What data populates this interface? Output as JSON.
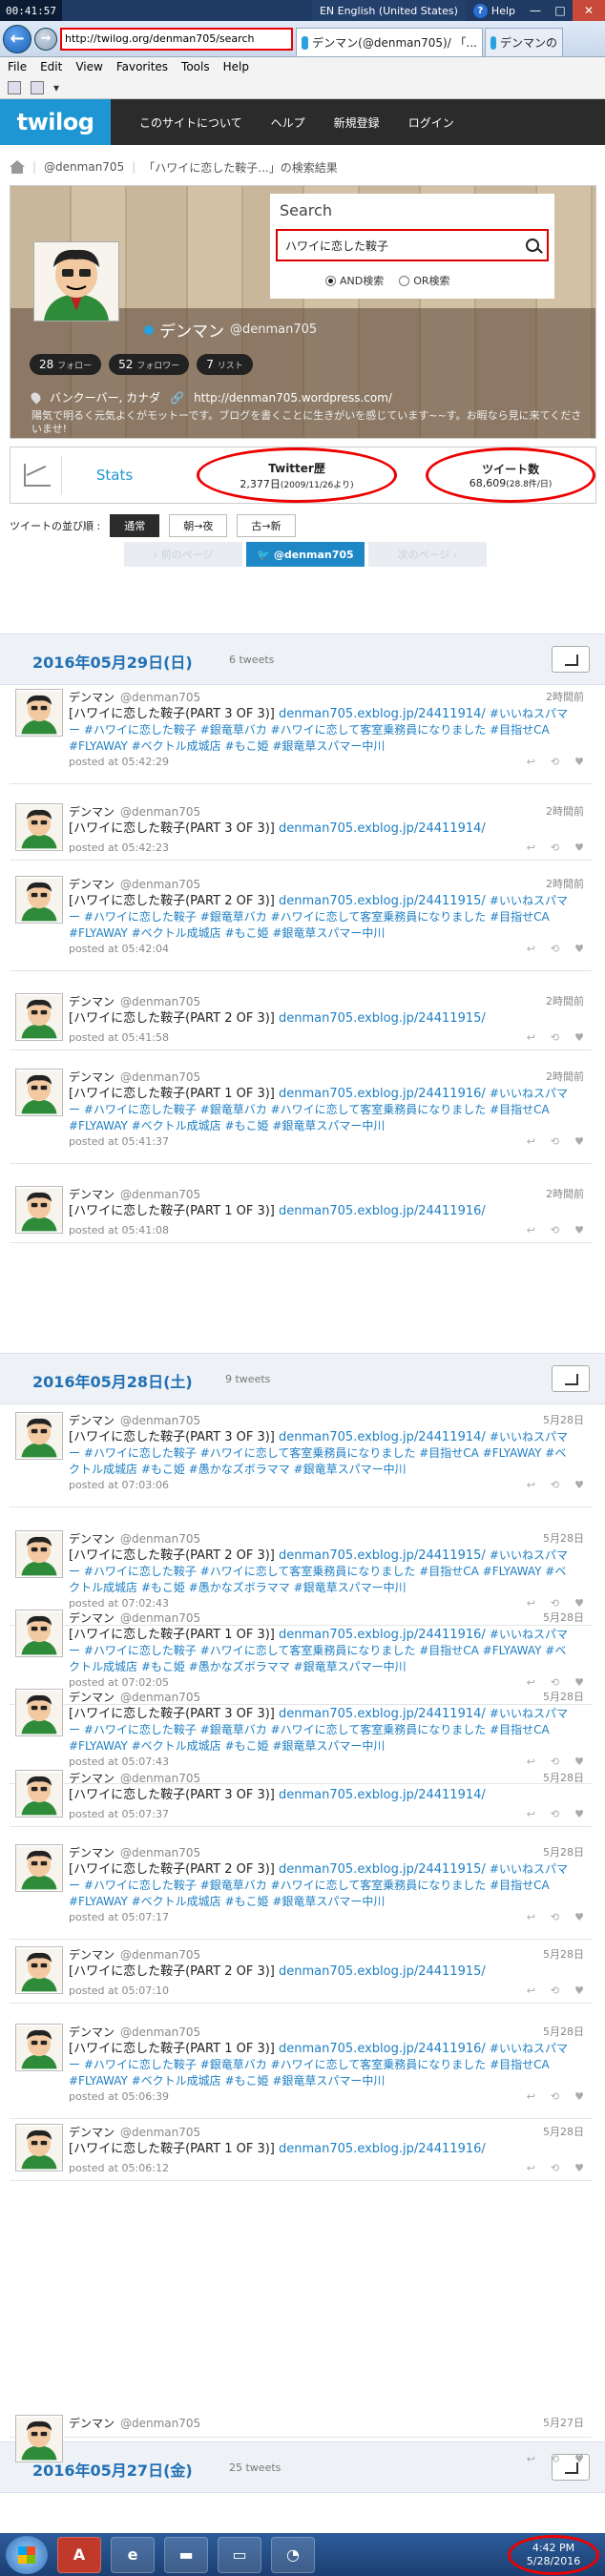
{
  "window": {
    "clock": "00:41:57",
    "language": "EN English (United States)",
    "help": "Help"
  },
  "browser": {
    "address": "http://twilog.org/denman705/search",
    "tabs": [
      {
        "label": "デンマン(@denman705)/ 「..."
      },
      {
        "label": "デンマンの"
      }
    ],
    "menu": [
      "File",
      "Edit",
      "View",
      "Favorites",
      "Tools",
      "Help"
    ]
  },
  "site": {
    "logo": "twilog",
    "nav": [
      "このサイトについて",
      "ヘルプ",
      "新規登録",
      "ログイン"
    ]
  },
  "breadcrumb": {
    "user": "@denman705",
    "current": "「ハワイに恋した鞍子...」の検索結果"
  },
  "search": {
    "title": "Search",
    "query": "ハワイに恋した鞍子",
    "and_label": "AND検索",
    "or_label": "OR検索"
  },
  "profile": {
    "name": "デンマン",
    "handle": "@denman705",
    "follow": "28",
    "follow_label": "フォロー",
    "followers": "52",
    "followers_label": "フォロワー",
    "lists": "7",
    "lists_label": "リスト",
    "location": "バンクーバー, カナダ",
    "url": "http://denman705.wordpress.com/",
    "bio": "陽気で明るく元気よくがモットーです。ブログを書くことに生きがいを感じています~~す。お暇なら見に来てくださいませ!"
  },
  "stats": {
    "label": "Stats",
    "history_title": "Twitter歴",
    "history_value": "2,377日",
    "history_note": "(2009/11/26より)",
    "tweets_title": "ツイート数",
    "tweets_value": "68,609",
    "tweets_note": "(28.8件/日)"
  },
  "sort": {
    "label": "ツイートの並び順 :",
    "options": [
      "通常",
      "朝→夜",
      "古→新"
    ]
  },
  "pager": {
    "prev": "前のページ",
    "user": "@denman705",
    "next": "次のページ"
  },
  "days": [
    {
      "date": "2016年05月29日(日)",
      "count": "6 tweets"
    },
    {
      "date": "2016年05月28日(土)",
      "count": "9 tweets"
    },
    {
      "date": "2016年05月27日(金)",
      "count": "25 tweets"
    }
  ],
  "tweets": [
    {
      "name": "デンマン",
      "handle": "@denman705",
      "time": "2時間前",
      "head": "[ハワイに恋した鞍子(PART 3 OF 3)]",
      "url": "denman705.exblog.jp/24411914/",
      "tags": "#いいねスパマー #ハワイに恋した鞍子 #銀竜草バカ #ハワイに恋して客室乗務員になりました #目指せCA #FLYAWAY #ベクトル成城店 #もこ姫 #銀竜草スパマー中川",
      "posted": "posted at 05:42:29"
    },
    {
      "name": "デンマン",
      "handle": "@denman705",
      "time": "2時間前",
      "head": "[ハワイに恋した鞍子(PART 3 OF 3)]",
      "url": "denman705.exblog.jp/24411914/",
      "tags": "",
      "posted": "posted at 05:42:23"
    },
    {
      "name": "デンマン",
      "handle": "@denman705",
      "time": "2時間前",
      "head": "[ハワイに恋した鞍子(PART 2 OF 3)]",
      "url": "denman705.exblog.jp/24411915/",
      "tags": "#いいねスパマー #ハワイに恋した鞍子 #銀竜草バカ #ハワイに恋して客室乗務員になりました #目指せCA #FLYAWAY #ベクトル成城店 #もこ姫 #銀竜草スパマー中川",
      "posted": "posted at 05:42:04"
    },
    {
      "name": "デンマン",
      "handle": "@denman705",
      "time": "2時間前",
      "head": "[ハワイに恋した鞍子(PART 2 OF 3)]",
      "url": "denman705.exblog.jp/24411915/",
      "tags": "",
      "posted": "posted at 05:41:58"
    },
    {
      "name": "デンマン",
      "handle": "@denman705",
      "time": "2時間前",
      "head": "[ハワイに恋した鞍子(PART 1 OF 3)]",
      "url": "denman705.exblog.jp/24411916/",
      "tags": "#いいねスパマー #ハワイに恋した鞍子 #銀竜草バカ #ハワイに恋して客室乗務員になりました #目指せCA #FLYAWAY #ベクトル成城店 #もこ姫 #銀竜草スパマー中川",
      "posted": "posted at 05:41:37"
    },
    {
      "name": "デンマン",
      "handle": "@denman705",
      "time": "2時間前",
      "head": "[ハワイに恋した鞍子(PART 1 OF 3)]",
      "url": "denman705.exblog.jp/24411916/",
      "tags": "",
      "posted": "posted at 05:41:08"
    },
    {
      "name": "デンマン",
      "handle": "@denman705",
      "time": "5月28日",
      "head": "[ハワイに恋した鞍子(PART 3 OF 3)]",
      "url": "denman705.exblog.jp/24411914/",
      "tags": "#いいねスパマー #ハワイに恋した鞍子 #ハワイに恋して客室乗務員になりました #目指せCA #FLYAWAY #ベクトル成城店 #もこ姫 #愚かなズボラママ #銀竜草スパマー中川",
      "posted": "posted at 07:03:06"
    },
    {
      "name": "デンマン",
      "handle": "@denman705",
      "time": "5月28日",
      "head": "[ハワイに恋した鞍子(PART 2 OF 3)]",
      "url": "denman705.exblog.jp/24411915/",
      "tags": "#いいねスパマー #ハワイに恋した鞍子 #ハワイに恋して客室乗務員になりました #目指せCA #FLYAWAY #ベクトル成城店 #もこ姫 #愚かなズボラママ #銀竜草スパマー中川",
      "posted": "posted at 07:02:43"
    },
    {
      "name": "デンマン",
      "handle": "@denman705",
      "time": "5月28日",
      "head": "[ハワイに恋した鞍子(PART 1 OF 3)]",
      "url": "denman705.exblog.jp/24411916/",
      "tags": "#いいねスパマー #ハワイに恋した鞍子 #ハワイに恋して客室乗務員になりました #目指せCA #FLYAWAY #ベクトル成城店 #もこ姫 #愚かなズボラママ #銀竜草スパマー中川",
      "posted": "posted at 07:02:05"
    },
    {
      "name": "デンマン",
      "handle": "@denman705",
      "time": "5月28日",
      "head": "[ハワイに恋した鞍子(PART 3 OF 3)]",
      "url": "denman705.exblog.jp/24411914/",
      "tags": "#いいねスパマー #ハワイに恋した鞍子 #銀竜草バカ #ハワイに恋して客室乗務員になりました #目指せCA #FLYAWAY #ベクトル成城店 #もこ姫 #銀竜草スパマー中川",
      "posted": "posted at 05:07:43"
    },
    {
      "name": "デンマン",
      "handle": "@denman705",
      "time": "5月28日",
      "head": "[ハワイに恋した鞍子(PART 3 OF 3)]",
      "url": "denman705.exblog.jp/24411914/",
      "tags": "",
      "posted": "posted at 05:07:37"
    },
    {
      "name": "デンマン",
      "handle": "@denman705",
      "time": "5月28日",
      "head": "[ハワイに恋した鞍子(PART 2 OF 3)]",
      "url": "denman705.exblog.jp/24411915/",
      "tags": "#いいねスパマー #ハワイに恋した鞍子 #銀竜草バカ #ハワイに恋して客室乗務員になりました #目指せCA #FLYAWAY #ベクトル成城店 #もこ姫 #銀竜草スパマー中川",
      "posted": "posted at 05:07:17"
    },
    {
      "name": "デンマン",
      "handle": "@denman705",
      "time": "5月28日",
      "head": "[ハワイに恋した鞍子(PART 2 OF 3)]",
      "url": "denman705.exblog.jp/24411915/",
      "tags": "",
      "posted": "posted at 05:07:10"
    },
    {
      "name": "デンマン",
      "handle": "@denman705",
      "time": "5月28日",
      "head": "[ハワイに恋した鞍子(PART 1 OF 3)]",
      "url": "denman705.exblog.jp/24411916/",
      "tags": "#いいねスパマー #ハワイに恋した鞍子 #銀竜草バカ #ハワイに恋して客室乗務員になりました #目指せCA #FLYAWAY #ベクトル成城店 #もこ姫 #銀竜草スパマー中川",
      "posted": "posted at 05:06:39"
    },
    {
      "name": "デンマン",
      "handle": "@denman705",
      "time": "5月28日",
      "head": "[ハワイに恋した鞍子(PART 1 OF 3)]",
      "url": "denman705.exblog.jp/24411916/",
      "tags": "",
      "posted": "posted at 05:06:12"
    },
    {
      "name": "デンマン",
      "handle": "@denman705",
      "time": "5月27日",
      "head": "",
      "url": "",
      "tags": "",
      "posted": ""
    }
  ],
  "taskbar": {
    "time": "4:42 PM",
    "date": "5/28/2016"
  }
}
